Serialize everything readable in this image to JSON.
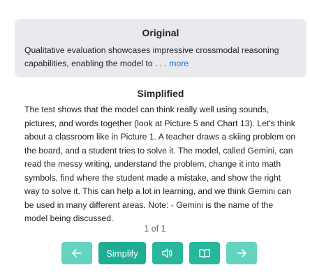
{
  "original": {
    "title": "Original",
    "text": "Qualitative evaluation showcases impressive crossmodal reasoning capabilities, enabling the model to . . . ",
    "more_label": "more"
  },
  "simplified": {
    "title": "Simplified",
    "text": "The test shows that the model can think really well using sounds, pictures, and words together (look at Picture 5 and Chart 13). Let's think about a classroom like in Picture 1. A teacher draws a skiing problem on the board, and a student tries to solve it. The model, called Gemini, can read the messy writing, understand the problem, change it into math symbols, find where the student made a mistake, and show the right way to solve it. This can help a lot in learning, and we think Gemini can be used in many different areas. Note: - Gemini is the name of the model being discussed."
  },
  "pagination": {
    "label": "1 of 1"
  },
  "toolbar": {
    "simplify_label": "Simplify",
    "icons": [
      "arrow-left-icon",
      "speaker-icon",
      "book-icon",
      "arrow-right-icon"
    ],
    "accent_color": "#1fae93",
    "light_color": "#64d3bf"
  }
}
